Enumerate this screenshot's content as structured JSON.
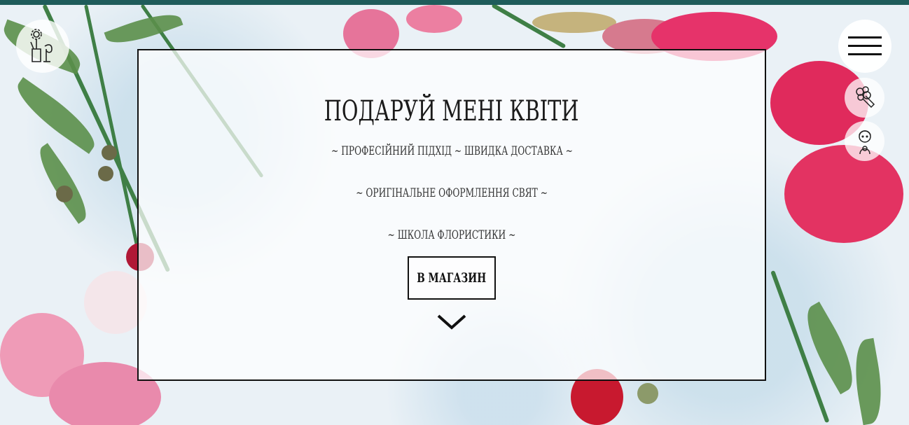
{
  "hero": {
    "title": "ПОДАРУЙ МЕНІ КВІТИ",
    "taglines": [
      "~ ПРОФЕСІЙНИЙ ПІДХІД ~ ШВИДКА ДОСТАВКА ~",
      "~ ОРИГІНАЛЬНЕ ОФОРМЛЕННЯ СВЯТ ~",
      "~ ШКОЛА ФЛОРИСТИКИ ~"
    ],
    "shop_button": "В МАГАЗИН"
  },
  "icons": {
    "logo": "flower-vase-icon",
    "menu": "hamburger-menu-icon",
    "bouquet": "bouquet-icon",
    "florist": "florist-girl-icon",
    "scroll": "chevron-down-icon"
  },
  "colors": {
    "top_bar": "#1f5c5b",
    "text": "#1b1b1b",
    "card_border": "#111111"
  }
}
